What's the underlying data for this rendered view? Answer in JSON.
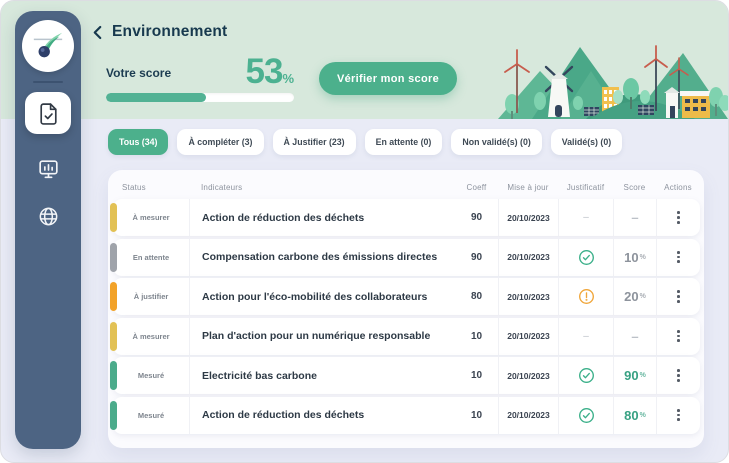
{
  "header": {
    "title": "Environnement",
    "score_label": "Votre score",
    "score_value": "53",
    "score_unit": "%",
    "score_percent": 53,
    "verify_button_label": "Vérifier mon score"
  },
  "sidebar": {
    "logo": "comet-logo",
    "items": [
      {
        "id": "documents",
        "icon": "document-check-icon",
        "active": true
      },
      {
        "id": "dashboard",
        "icon": "monitor-chart-icon",
        "active": false
      },
      {
        "id": "web",
        "icon": "globe-icon",
        "active": false
      }
    ]
  },
  "tabs": [
    {
      "label": "Tous (34)",
      "active": true
    },
    {
      "label": "À compléter (3)",
      "active": false
    },
    {
      "label": "À Justifier (23)",
      "active": false
    },
    {
      "label": "En attente (0)",
      "active": false
    },
    {
      "label": "Non validé(s) (0)",
      "active": false
    },
    {
      "label": "Validé(s) (0)",
      "active": false
    }
  ],
  "table": {
    "columns": [
      "Status",
      "Indicateurs",
      "Coeff",
      "Mise à jour",
      "Justificatif",
      "Score",
      "Actions"
    ],
    "empty_placeholder": "–",
    "rows": [
      {
        "status": "À mesurer",
        "status_color": "#e2c155",
        "indicator": "Action de réduction des déchets",
        "coeff": "90",
        "updated": "20/10/2023",
        "justificatif": "none",
        "score": null,
        "score_color": null
      },
      {
        "status": "En attente",
        "status_color": "#9fa3aa",
        "indicator": "Compensation carbone des émissions directes",
        "coeff": "90",
        "updated": "20/10/2023",
        "justificatif": "check",
        "score": "10",
        "score_color": "gray"
      },
      {
        "status": "À justifier",
        "status_color": "#f2a229",
        "indicator": "Action pour l'éco-mobilité des collaborateurs",
        "coeff": "80",
        "updated": "20/10/2023",
        "justificatif": "warning",
        "score": "20",
        "score_color": "gray"
      },
      {
        "status": "À mesurer",
        "status_color": "#e2c155",
        "indicator": "Plan d'action pour un numérique responsable",
        "coeff": "10",
        "updated": "20/10/2023",
        "justificatif": "none",
        "score": null,
        "score_color": null
      },
      {
        "status": "Mesuré",
        "status_color": "#4bab8b",
        "indicator": "Electricité bas carbone",
        "coeff": "10",
        "updated": "20/10/2023",
        "justificatif": "check",
        "score": "90",
        "score_color": "green"
      },
      {
        "status": "Mesuré",
        "status_color": "#4bab8b",
        "indicator": "Action de réduction des déchets",
        "coeff": "10",
        "updated": "20/10/2023",
        "justificatif": "check",
        "score": "80",
        "score_color": "green"
      }
    ]
  },
  "colors": {
    "accent_green": "#4cb08c",
    "score_green": "#38a183",
    "band_green": "#d7e8dc",
    "background": "#e9ebf6",
    "sidebar_blue": "#4d6483",
    "status_yellow": "#e2c155",
    "status_orange": "#f2a229",
    "status_gray": "#9fa3aa",
    "status_green": "#4bab8b"
  }
}
